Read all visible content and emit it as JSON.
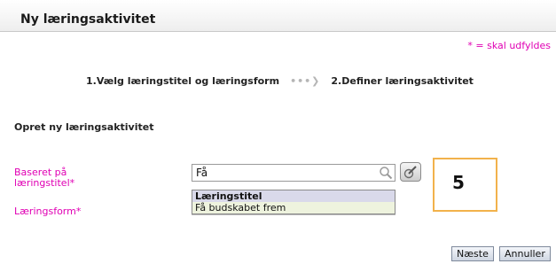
{
  "header": {
    "title": "Ny læringsaktivitet"
  },
  "required_note": "* = skal udfyldes",
  "steps": {
    "step1": "1.Vælg læringstitel og læringsform",
    "arrow": "•••❯",
    "step2": "2.Definer læringsaktivitet"
  },
  "section_title": "Opret ny læringsaktivitet",
  "form": {
    "based_on_label": "Baseret på læringstitel*",
    "search_value": "Få",
    "form_label": "Læringsform*"
  },
  "dropdown": {
    "group_header": "Læringstitel",
    "options": [
      "Få budskabet frem"
    ]
  },
  "annotation": {
    "number": "5",
    "color": "#f2b24b"
  },
  "buttons": {
    "next": "Næste",
    "cancel": "Annuller"
  },
  "colors": {
    "required": "#e000b4",
    "highlight": "#eef3de",
    "group_header": "#d9d9ea"
  }
}
